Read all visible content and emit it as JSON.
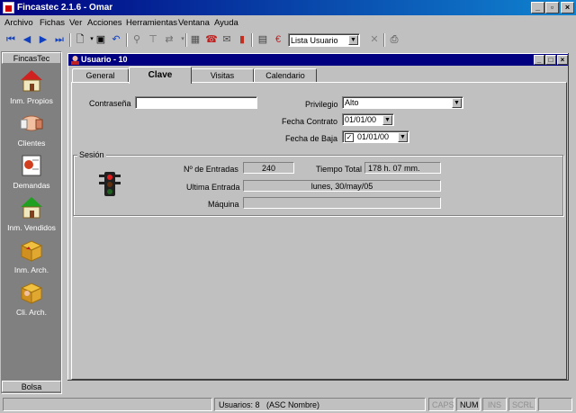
{
  "window": {
    "title": "Fincastec 2.1.6 - Omar"
  },
  "menu": [
    "Archivo",
    "Fichas",
    "Ver",
    "Acciones",
    "Herramientas",
    "Ventana",
    "Ayuda"
  ],
  "toolbar": {
    "list_select": "Lista Usuario"
  },
  "sidebar": {
    "header": "FincasTec",
    "footer": "Bolsa",
    "items": [
      {
        "label": "Inm. Propios",
        "icon": "house-icon"
      },
      {
        "label": "Clientes",
        "icon": "handshake-icon"
      },
      {
        "label": "Demandas",
        "icon": "document-icon"
      },
      {
        "label": "Inm. Vendidos",
        "icon": "sold-house-icon"
      },
      {
        "label": "Inm. Arch.",
        "icon": "archive-box-icon"
      },
      {
        "label": "Cli. Arch.",
        "icon": "client-archive-icon"
      }
    ]
  },
  "child": {
    "title": "Usuario - 10"
  },
  "tabs": [
    "General",
    "Clave",
    "Visitas",
    "Calendario"
  ],
  "form": {
    "password_label": "Contraseña",
    "password_value": "",
    "privilege_label": "Privilegio",
    "privilege_value": "Alto",
    "contract_label": "Fecha Contrato",
    "contract_value": "01/01/00",
    "leave_label": "Fecha de Baja",
    "leave_value": "01/01/00"
  },
  "session": {
    "title": "Sesión",
    "entries_label": "Nº de Entradas",
    "entries_value": "240",
    "total_label": "Tiempo Total",
    "total_value": "178 h. 07 mm.",
    "last_label": "Ultima Entrada",
    "last_value": "lunes, 30/may/05",
    "machine_label": "Máquina",
    "machine_value": ""
  },
  "status": {
    "users": "Usuarios: 8",
    "order": "(ASC Nombre)",
    "caps": "CAPS",
    "num": "NUM",
    "ins": "INS",
    "scrl": "SCRL"
  }
}
